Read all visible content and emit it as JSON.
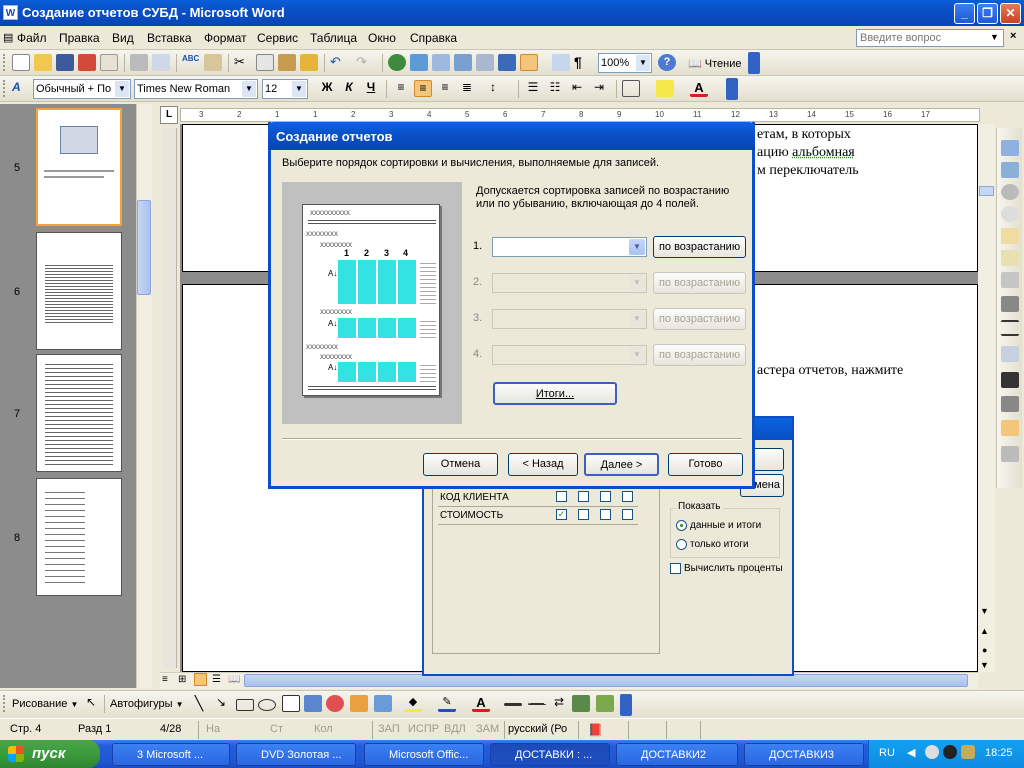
{
  "window": {
    "title": "Создание отчетов СУБД - Microsoft Word",
    "app_icon_letter": "W"
  },
  "menu": {
    "items": [
      "Файл",
      "Правка",
      "Вид",
      "Вставка",
      "Формат",
      "Сервис",
      "Таблица",
      "Окно",
      "Справка"
    ],
    "ask_placeholder": "Введите вопрос"
  },
  "standard_toolbar": {
    "zoom": "100%",
    "reading_label": "Чтение"
  },
  "formatting_toolbar": {
    "style": "Обычный + По ц",
    "font": "Times New Roman",
    "size": "12",
    "bold": "Ж",
    "italic": "К",
    "underline": "Ч"
  },
  "thumbnails": [
    {
      "num": "5"
    },
    {
      "num": "6"
    },
    {
      "num": "7"
    },
    {
      "num": "8"
    }
  ],
  "ruler": {
    "marks": [
      "3",
      "2",
      "1",
      "1",
      "2",
      "3",
      "4",
      "5",
      "6",
      "7",
      "8",
      "9",
      "10",
      "11",
      "12",
      "13",
      "14",
      "15",
      "16",
      "17"
    ]
  },
  "document": {
    "line1": "етам, в которых",
    "line2a": "ацию ",
    "line2b": "альбомная",
    "line3": "м переключатель",
    "line4": "астера отчетов, нажмите"
  },
  "bg_dialog": {
    "fields": [
      "КОД КЛИЕНТА",
      "СТОИМОСТЬ"
    ],
    "show_label": "Показать",
    "radio_data_totals": "данные и итоги",
    "radio_totals_only": "только итоги",
    "checkbox_percent": "Вычислить проценты",
    "right_button": "мена"
  },
  "dialog": {
    "title": "Создание отчетов",
    "instruction": "Выберите порядок сортировки и вычисления, выполняемые для записей.",
    "info_line1": "Допускается сортировка записей по возрастанию",
    "info_line2": "или по убыванию, включающая до 4 полей.",
    "rows": [
      {
        "num": "1.",
        "sort_label": "по возрастанию",
        "enabled": true
      },
      {
        "num": "2.",
        "sort_label": "по возрастанию",
        "enabled": false
      },
      {
        "num": "3.",
        "sort_label": "по возрастанию",
        "enabled": false
      },
      {
        "num": "4.",
        "sort_label": "по возрастанию",
        "enabled": false
      }
    ],
    "totals_button": "Итоги...",
    "cancel": "Отмена",
    "back": "< Назад",
    "next": "Далее >",
    "finish": "Готово",
    "preview": {
      "header_x": "xxxxxxxxxx",
      "group_x": "xxxxxxxx",
      "col_nums": [
        "1",
        "2",
        "3",
        "4"
      ],
      "az": "А↓Я"
    }
  },
  "drawing_toolbar": {
    "draw_label": "Рисование",
    "autoshapes_label": "Автофигуры"
  },
  "status": {
    "page": "Стр. 4",
    "section": "Разд 1",
    "pages": "4/28",
    "at": "На",
    "line": "Ст",
    "col": "Кол",
    "rec": "ЗАП",
    "trk": "ИСПР",
    "ext": "ВДЛ",
    "ovr": "ЗАМ",
    "lang": "русский (Ро"
  },
  "taskbar": {
    "start": "пуск",
    "tasks": [
      {
        "label": "3 Microsoft ...",
        "active": false
      },
      {
        "label": "DVD Золотая ...",
        "active": false
      },
      {
        "label": "Microsoft Offic...",
        "active": false
      },
      {
        "label": "ДОСТАВКИ : ...",
        "active": true
      },
      {
        "label": "ДОСТАВКИ2",
        "active": false
      },
      {
        "label": "ДОСТАВКИ3",
        "active": false
      }
    ],
    "lang": "RU",
    "time": "18:25"
  },
  "colors": {
    "title_blue": "#0a4fc4",
    "preview_cyan": "#33e3e3",
    "selected_thumb": "#f2a33a"
  }
}
